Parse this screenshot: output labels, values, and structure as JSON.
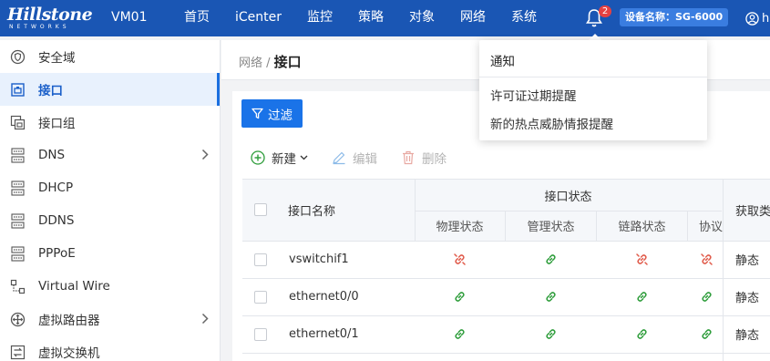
{
  "app": {
    "brand": "Hillstone",
    "brand_sub": "NETWORKS",
    "instance": "VM01",
    "device_badge": "设备名称：SG-6000",
    "user_initial": "h",
    "notification_count": "2",
    "colors": {
      "topbar": "#1a56b4",
      "accent": "#1a73e8",
      "link_ok": "#2e9d3b",
      "link_down": "#e05a4a"
    }
  },
  "nav": [
    "首页",
    "iCenter",
    "监控",
    "策略",
    "对象",
    "网络",
    "系统"
  ],
  "sidebar": {
    "items": [
      {
        "label": "安全域",
        "icon": "security-zone-icon",
        "active": false,
        "has_children": false
      },
      {
        "label": "接口",
        "icon": "interface-icon",
        "active": true,
        "has_children": false
      },
      {
        "label": "接口组",
        "icon": "interface-group-icon",
        "active": false,
        "has_children": false
      },
      {
        "label": "DNS",
        "icon": "dns-icon",
        "active": false,
        "has_children": true
      },
      {
        "label": "DHCP",
        "icon": "dhcp-icon",
        "active": false,
        "has_children": false
      },
      {
        "label": "DDNS",
        "icon": "ddns-icon",
        "active": false,
        "has_children": false
      },
      {
        "label": "PPPoE",
        "icon": "pppoe-icon",
        "active": false,
        "has_children": false
      },
      {
        "label": "Virtual Wire",
        "icon": "virtual-wire-icon",
        "active": false,
        "has_children": false
      },
      {
        "label": "虚拟路由器",
        "icon": "virtual-router-icon",
        "active": false,
        "has_children": true
      },
      {
        "label": "虚拟交换机",
        "icon": "virtual-switch-icon",
        "active": false,
        "has_children": false
      }
    ]
  },
  "breadcrumb": {
    "parent": "网络",
    "separator": " / ",
    "current": "接口"
  },
  "toolbar": {
    "filter": "过滤",
    "new": "新建",
    "edit": "编辑",
    "delete": "删除"
  },
  "table": {
    "col_name": "接口名称",
    "group_status": "接口状态",
    "sub_physical": "物理状态",
    "sub_admin": "管理状态",
    "sub_link": "链路状态",
    "sub_protocol": "协议",
    "col_acquire": "获取类",
    "rows": [
      {
        "name": "vswitchif1",
        "physical": "down",
        "admin": "up",
        "link": "down",
        "protocol": "down",
        "acquire": "静态"
      },
      {
        "name": "ethernet0/0",
        "physical": "up",
        "admin": "up",
        "link": "up",
        "protocol": "up",
        "acquire": "静态"
      },
      {
        "name": "ethernet0/1",
        "physical": "up",
        "admin": "up",
        "link": "up",
        "protocol": "up",
        "acquire": "静态"
      }
    ]
  },
  "notifications": {
    "title": "通知",
    "items": [
      "许可证过期提醒",
      "新的热点威胁情报提醒"
    ]
  }
}
